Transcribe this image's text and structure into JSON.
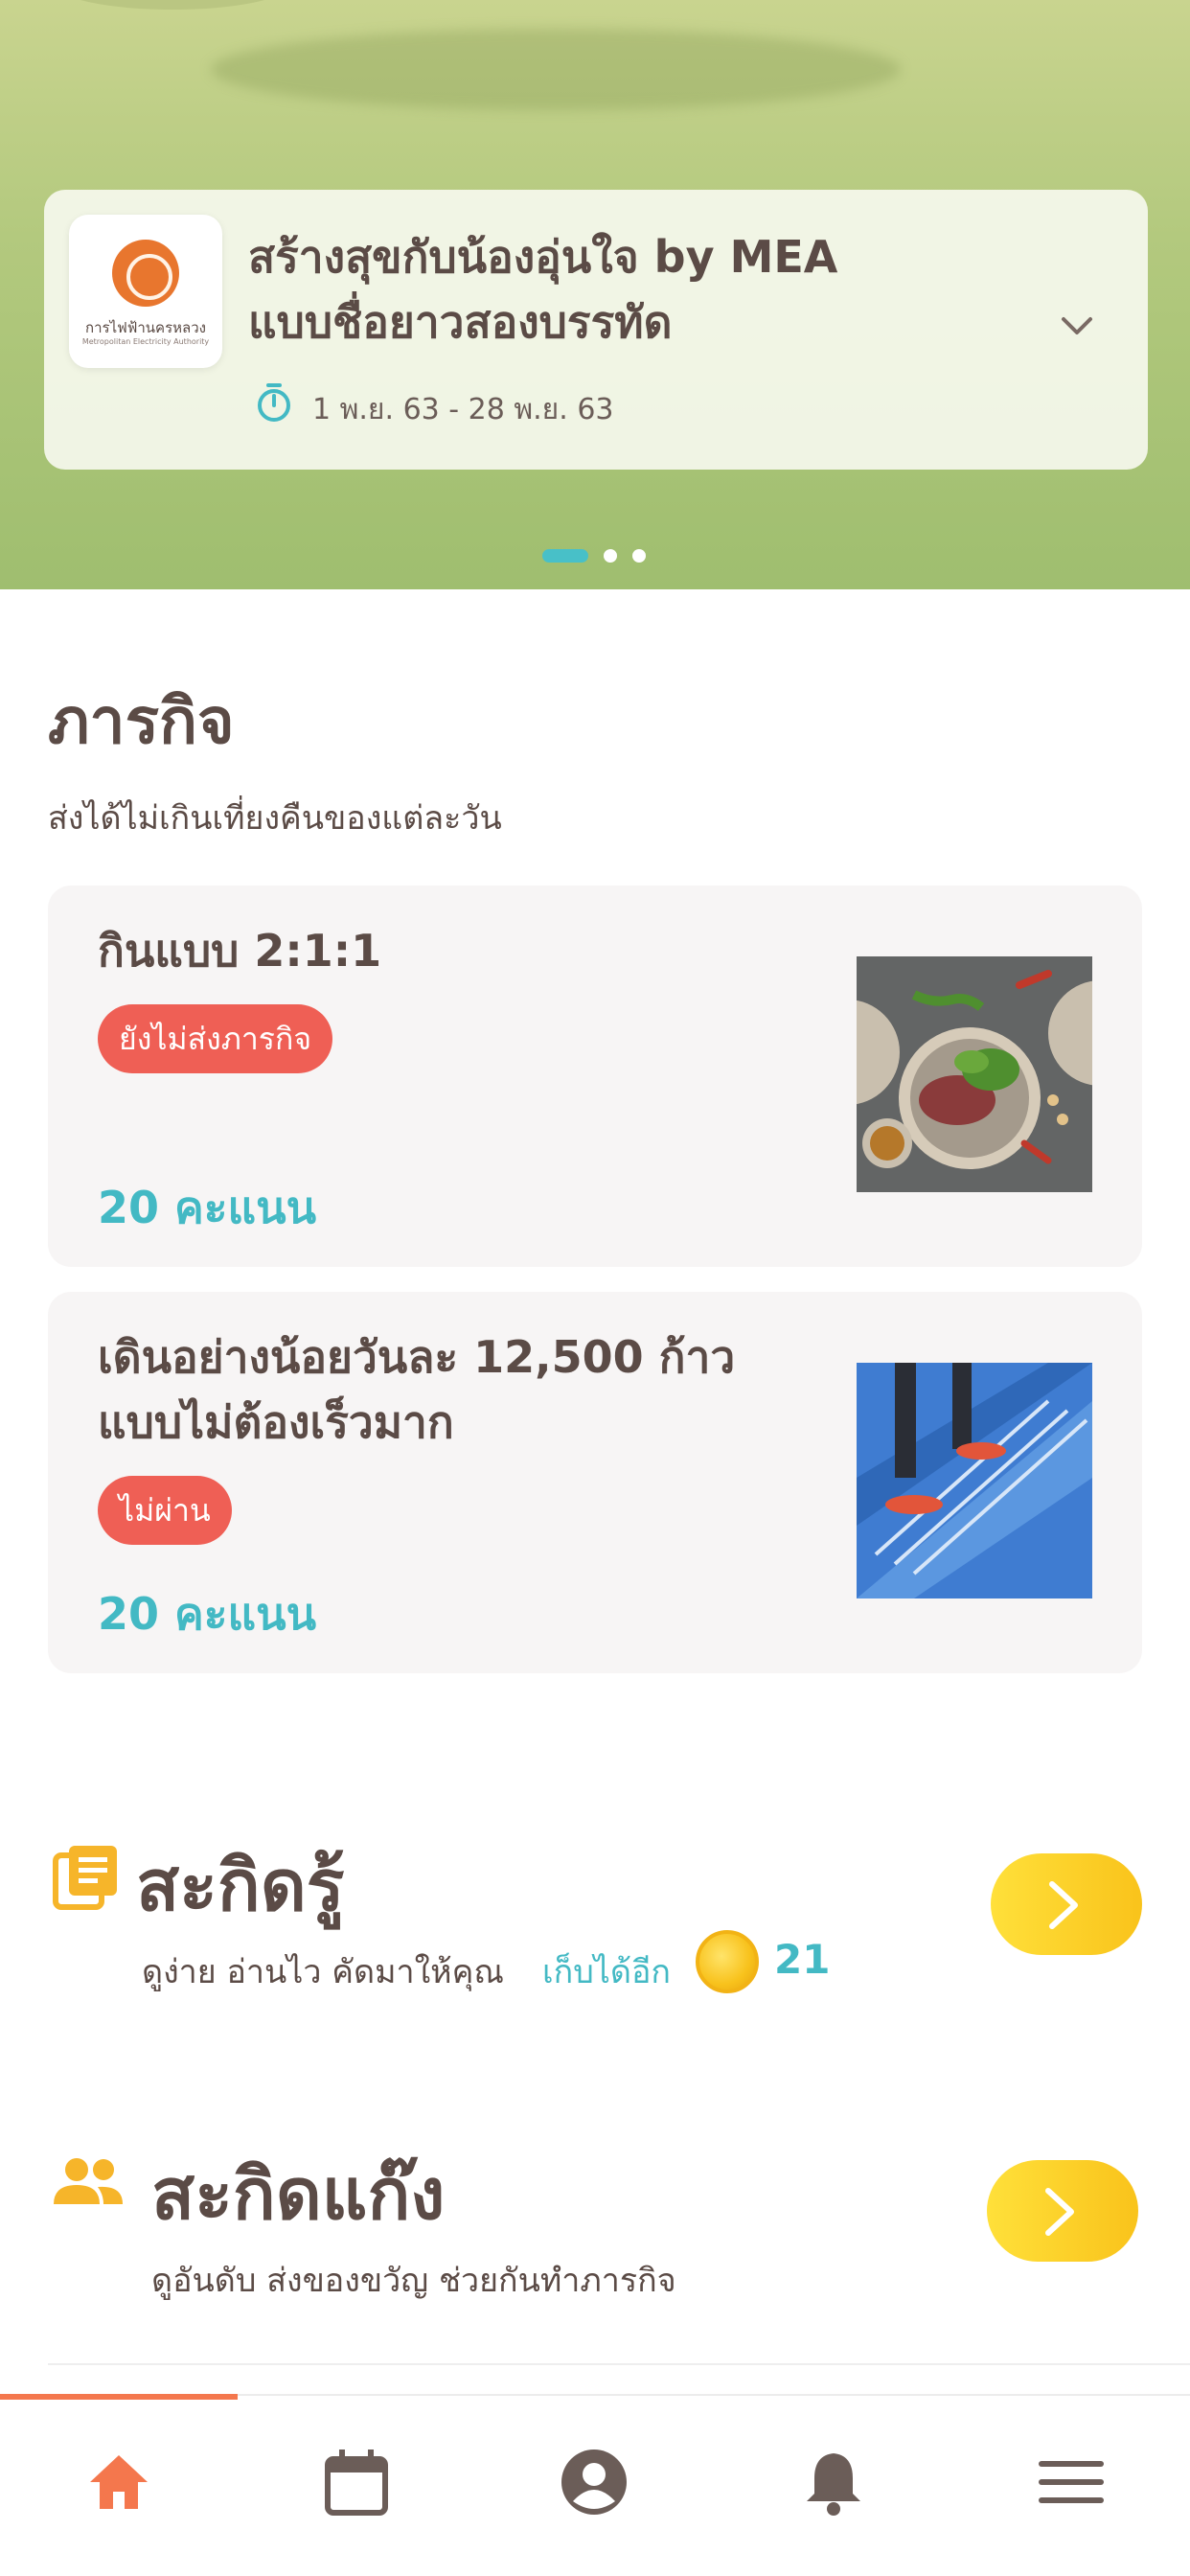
{
  "hero": {
    "logo_text": "การไฟฟ้านครหลวง",
    "logo_subtext": "Metropolitan Electricity Authority",
    "campaign_title_line1": "สร้างสุขกับน้องอุ่นใจ by MEA",
    "campaign_title_line2": "แบบชื่อยาวสองบรรทัด",
    "campaign_dates": "1 พ.ย. 63 -  28 พ.ย. 63",
    "carousel_pages": 3,
    "carousel_active": 1
  },
  "missions": {
    "title": "ภารกิจ",
    "subtitle": "ส่งได้ไม่เกินเที่ยงคืนของแต่ละวัน",
    "items": [
      {
        "title_line1": "กินแบบ 2:1:1",
        "title_line2": "",
        "status": "ยังไม่ส่งภารกิจ",
        "points": "20 คะแนน",
        "image": "food-plate-image"
      },
      {
        "title_line1": "เดินอย่างน้อยวันละ 12,500 ก้าว",
        "title_line2": "แบบไม่ต้องเร็วมาก",
        "status": "ไม่ผ่าน",
        "points": "20 คะแนน",
        "image": "walking-stairs-image"
      }
    ]
  },
  "knowledge": {
    "title": "สะกิดรู้",
    "subtitle": "ดูง่าย อ่านไว คัดมาให้คุณ",
    "collect_more": "เก็บได้อีก",
    "coins": "21",
    "icon": "article-icon"
  },
  "gang": {
    "title": "สะกิดแก๊ง",
    "subtitle": "ดูอันดับ ส่งของขวัญ ช่วยกันทำภารกิจ",
    "icon": "group-icon"
  },
  "bottom_nav": {
    "items": [
      "home-icon",
      "calendar-icon",
      "profile-icon",
      "bell-icon",
      "menu-icon"
    ],
    "active": 0
  },
  "colors": {
    "accent_teal": "#43b9c4",
    "badge_red": "#ef5f55",
    "button_yellow": "#f9c31b",
    "nav_active_orange": "#f4774d",
    "text_brown": "#5b4b46"
  }
}
